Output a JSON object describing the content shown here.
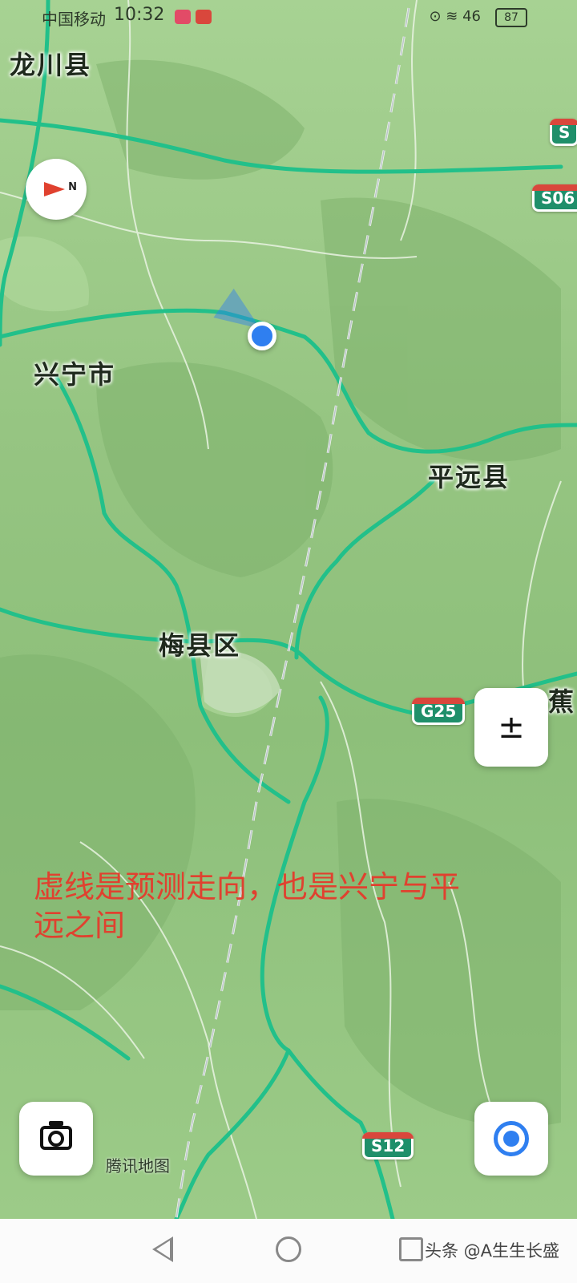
{
  "status_bar": {
    "carrier": "中国移动",
    "time": "10:32",
    "network": "46",
    "battery": "87"
  },
  "map": {
    "places": [
      {
        "name": "龙川县"
      },
      {
        "name": "兴宁市"
      },
      {
        "name": "平远县"
      },
      {
        "name": "梅县区"
      },
      {
        "name": "蕉"
      }
    ],
    "shields": [
      "S",
      "S06",
      "G25",
      "S12"
    ],
    "compass_label": "N",
    "annotation": "虚线是预测走向，也是兴宁与平远之间",
    "attribution": "腾讯地图",
    "colors": {
      "terrain": "#9cc889",
      "road": "#22c08a",
      "annotation": "#e0412f",
      "location": "#2f7ff0"
    }
  },
  "controls": {
    "zoom_icon": "±",
    "camera": "camera-icon",
    "locate": "locate-icon"
  },
  "navbar": {
    "watermark": "头条 @A生生长盛"
  }
}
